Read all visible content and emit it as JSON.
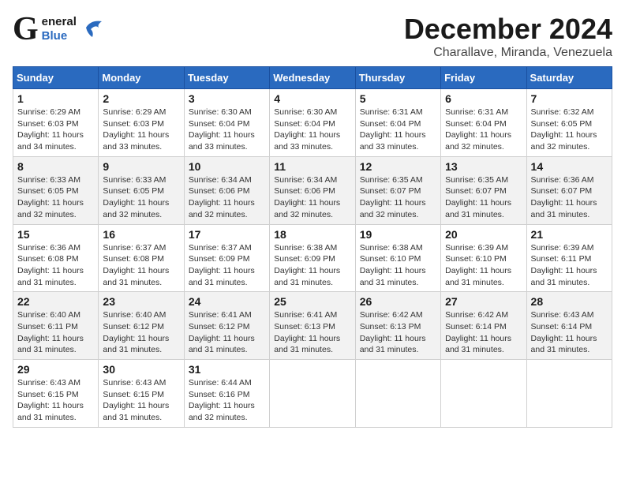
{
  "header": {
    "logo_general": "General",
    "logo_blue": "Blue",
    "month": "December 2024",
    "location": "Charallave, Miranda, Venezuela"
  },
  "days_of_week": [
    "Sunday",
    "Monday",
    "Tuesday",
    "Wednesday",
    "Thursday",
    "Friday",
    "Saturday"
  ],
  "weeks": [
    [
      {
        "day": "1",
        "sunrise": "6:29 AM",
        "sunset": "6:03 PM",
        "daylight": "11 hours and 34 minutes."
      },
      {
        "day": "2",
        "sunrise": "6:29 AM",
        "sunset": "6:03 PM",
        "daylight": "11 hours and 33 minutes."
      },
      {
        "day": "3",
        "sunrise": "6:30 AM",
        "sunset": "6:04 PM",
        "daylight": "11 hours and 33 minutes."
      },
      {
        "day": "4",
        "sunrise": "6:30 AM",
        "sunset": "6:04 PM",
        "daylight": "11 hours and 33 minutes."
      },
      {
        "day": "5",
        "sunrise": "6:31 AM",
        "sunset": "6:04 PM",
        "daylight": "11 hours and 33 minutes."
      },
      {
        "day": "6",
        "sunrise": "6:31 AM",
        "sunset": "6:04 PM",
        "daylight": "11 hours and 32 minutes."
      },
      {
        "day": "7",
        "sunrise": "6:32 AM",
        "sunset": "6:05 PM",
        "daylight": "11 hours and 32 minutes."
      }
    ],
    [
      {
        "day": "8",
        "sunrise": "6:33 AM",
        "sunset": "6:05 PM",
        "daylight": "11 hours and 32 minutes."
      },
      {
        "day": "9",
        "sunrise": "6:33 AM",
        "sunset": "6:05 PM",
        "daylight": "11 hours and 32 minutes."
      },
      {
        "day": "10",
        "sunrise": "6:34 AM",
        "sunset": "6:06 PM",
        "daylight": "11 hours and 32 minutes."
      },
      {
        "day": "11",
        "sunrise": "6:34 AM",
        "sunset": "6:06 PM",
        "daylight": "11 hours and 32 minutes."
      },
      {
        "day": "12",
        "sunrise": "6:35 AM",
        "sunset": "6:07 PM",
        "daylight": "11 hours and 32 minutes."
      },
      {
        "day": "13",
        "sunrise": "6:35 AM",
        "sunset": "6:07 PM",
        "daylight": "11 hours and 31 minutes."
      },
      {
        "day": "14",
        "sunrise": "6:36 AM",
        "sunset": "6:07 PM",
        "daylight": "11 hours and 31 minutes."
      }
    ],
    [
      {
        "day": "15",
        "sunrise": "6:36 AM",
        "sunset": "6:08 PM",
        "daylight": "11 hours and 31 minutes."
      },
      {
        "day": "16",
        "sunrise": "6:37 AM",
        "sunset": "6:08 PM",
        "daylight": "11 hours and 31 minutes."
      },
      {
        "day": "17",
        "sunrise": "6:37 AM",
        "sunset": "6:09 PM",
        "daylight": "11 hours and 31 minutes."
      },
      {
        "day": "18",
        "sunrise": "6:38 AM",
        "sunset": "6:09 PM",
        "daylight": "11 hours and 31 minutes."
      },
      {
        "day": "19",
        "sunrise": "6:38 AM",
        "sunset": "6:10 PM",
        "daylight": "11 hours and 31 minutes."
      },
      {
        "day": "20",
        "sunrise": "6:39 AM",
        "sunset": "6:10 PM",
        "daylight": "11 hours and 31 minutes."
      },
      {
        "day": "21",
        "sunrise": "6:39 AM",
        "sunset": "6:11 PM",
        "daylight": "11 hours and 31 minutes."
      }
    ],
    [
      {
        "day": "22",
        "sunrise": "6:40 AM",
        "sunset": "6:11 PM",
        "daylight": "11 hours and 31 minutes."
      },
      {
        "day": "23",
        "sunrise": "6:40 AM",
        "sunset": "6:12 PM",
        "daylight": "11 hours and 31 minutes."
      },
      {
        "day": "24",
        "sunrise": "6:41 AM",
        "sunset": "6:12 PM",
        "daylight": "11 hours and 31 minutes."
      },
      {
        "day": "25",
        "sunrise": "6:41 AM",
        "sunset": "6:13 PM",
        "daylight": "11 hours and 31 minutes."
      },
      {
        "day": "26",
        "sunrise": "6:42 AM",
        "sunset": "6:13 PM",
        "daylight": "11 hours and 31 minutes."
      },
      {
        "day": "27",
        "sunrise": "6:42 AM",
        "sunset": "6:14 PM",
        "daylight": "11 hours and 31 minutes."
      },
      {
        "day": "28",
        "sunrise": "6:43 AM",
        "sunset": "6:14 PM",
        "daylight": "11 hours and 31 minutes."
      }
    ],
    [
      {
        "day": "29",
        "sunrise": "6:43 AM",
        "sunset": "6:15 PM",
        "daylight": "11 hours and 31 minutes."
      },
      {
        "day": "30",
        "sunrise": "6:43 AM",
        "sunset": "6:15 PM",
        "daylight": "11 hours and 31 minutes."
      },
      {
        "day": "31",
        "sunrise": "6:44 AM",
        "sunset": "6:16 PM",
        "daylight": "11 hours and 32 minutes."
      },
      null,
      null,
      null,
      null
    ]
  ]
}
